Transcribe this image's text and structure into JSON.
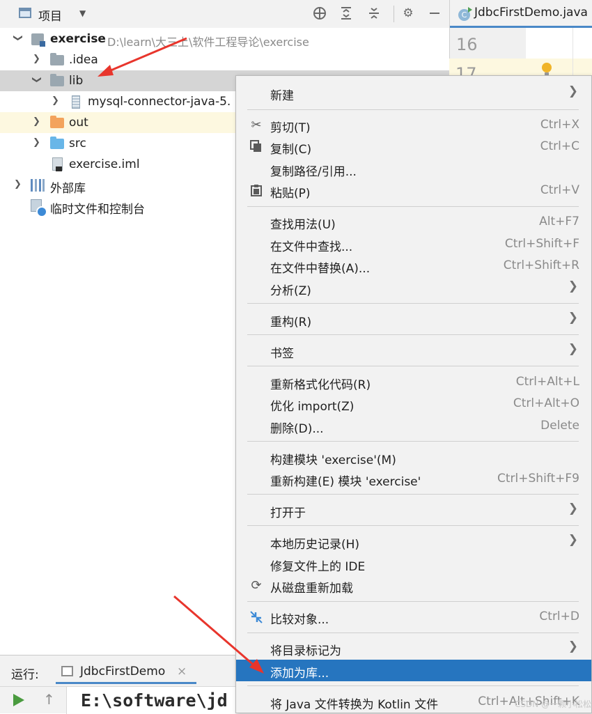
{
  "project_panel": {
    "title": "项目",
    "tree": {
      "root_name": "exercise",
      "root_path": "D:\\learn\\大三上\\软件工程导论\\exercise",
      "idea": ".idea",
      "lib": "lib",
      "jar": "mysql-connector-java-5.",
      "out": "out",
      "src": "src",
      "iml": "exercise.iml",
      "external_libraries": "外部库",
      "scratches": "临时文件和控制台"
    }
  },
  "editor": {
    "tab_title": "JdbcFirstDemo.java",
    "class_icon_letter": "C",
    "line_numbers": [
      "16",
      "17"
    ]
  },
  "context_menu": {
    "new": {
      "label": "新建"
    },
    "cut": {
      "label": "剪切(T)",
      "shortcut": "Ctrl+X"
    },
    "copy": {
      "label": "复制(C)",
      "shortcut": "Ctrl+C"
    },
    "copy_path": {
      "label": "复制路径/引用..."
    },
    "paste": {
      "label": "粘贴(P)",
      "shortcut": "Ctrl+V"
    },
    "find_usages": {
      "label": "查找用法(U)",
      "shortcut": "Alt+F7"
    },
    "find_in_files": {
      "label": "在文件中查找...",
      "shortcut": "Ctrl+Shift+F"
    },
    "replace_in_files": {
      "label": "在文件中替换(A)...",
      "shortcut": "Ctrl+Shift+R"
    },
    "analyze": {
      "label": "分析(Z)"
    },
    "refactor": {
      "label": "重构(R)"
    },
    "bookmarks": {
      "label": "书签"
    },
    "reformat": {
      "label": "重新格式化代码(R)",
      "shortcut": "Ctrl+Alt+L"
    },
    "optimize_imports": {
      "label": "优化 import(Z)",
      "shortcut": "Ctrl+Alt+O"
    },
    "delete": {
      "label": "删除(D)...",
      "shortcut": "Delete"
    },
    "build_module": {
      "label": "构建模块 'exercise'(M)"
    },
    "rebuild_module": {
      "label": "重新构建(E) 模块 'exercise'",
      "shortcut": "Ctrl+Shift+F9"
    },
    "open_in": {
      "label": "打开于"
    },
    "local_history": {
      "label": "本地历史记录(H)"
    },
    "repair_ide": {
      "label": "修复文件上的 IDE"
    },
    "reload_from_disk": {
      "label": "从磁盘重新加载"
    },
    "compare_with": {
      "label": "比较对象...",
      "shortcut": "Ctrl+D"
    },
    "mark_directory_as": {
      "label": "将目录标记为"
    },
    "add_as_library": {
      "label": "添加为库..."
    },
    "convert_to_kotlin": {
      "label": "将 Java 文件转换为 Kotlin 文件",
      "shortcut": "Ctrl+Alt+Shift+K"
    }
  },
  "run_panel": {
    "label": "运行:",
    "tab_label": "JdbcFirstDemo",
    "close_glyph": "×",
    "console_text": "E:\\software\\jd"
  },
  "watermark": "CSDN @一颗小松松",
  "colors": {
    "menu_highlight": "#2675bf",
    "selection_row": "#d5d5d5",
    "annotation_arrow": "#e8352c",
    "run_green": "#4a9b3f"
  },
  "icons": {
    "settings": "gear-icon",
    "locate": "crosshair-icon",
    "expand_all": "expand-all-icon",
    "collapse_all": "collapse-all-icon",
    "hide": "minimize-icon"
  }
}
